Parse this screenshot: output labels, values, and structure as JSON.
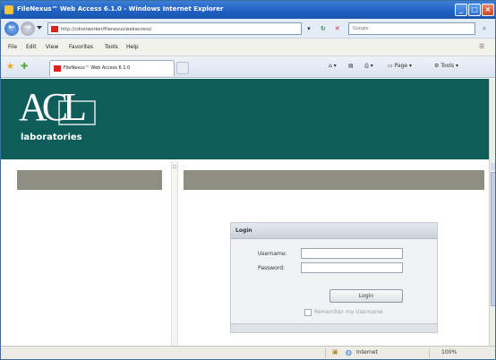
{
  "window": {
    "title": "FileNexus™ Web Access 6.1.0 - Windows Internet Explorer",
    "controls": {
      "minimize": "_",
      "maximize": "□",
      "close": "×"
    }
  },
  "addressbar": {
    "url": "http://cdnetworker/filenexus/webaccess/",
    "search_placeholder": "Google"
  },
  "menu": {
    "items": [
      "File",
      "Edit",
      "View",
      "Favorites",
      "Tools",
      "Help"
    ]
  },
  "tabs": {
    "active_label": "FileNexus™ Web Access 6.1.0"
  },
  "commandbar": {
    "page_label": "Page",
    "tools_label": "Tools"
  },
  "banner": {
    "logo_text": "ACL",
    "logo_subtext": "laboratories",
    "background_color": "#0e5d5a"
  },
  "login": {
    "header": "Login",
    "username_label": "Username:",
    "username_value": "",
    "password_label": "Password:",
    "password_value": "",
    "button_label": "Login",
    "remember_label": "Remember my Username",
    "remember_checked": false
  },
  "statusbar": {
    "zone": "Internet",
    "zoom": "100%"
  },
  "icons": {
    "back": "back-arrow-icon",
    "forward": "forward-arrow-icon",
    "refresh": "refresh-icon",
    "stop": "stop-icon",
    "search": "search-icon",
    "favorites": "favorites-star-icon",
    "add_favorites": "add-favorites-icon",
    "home": "home-icon",
    "feeds": "feeds-icon",
    "print": "print-icon",
    "internet_zone": "globe-icon"
  }
}
